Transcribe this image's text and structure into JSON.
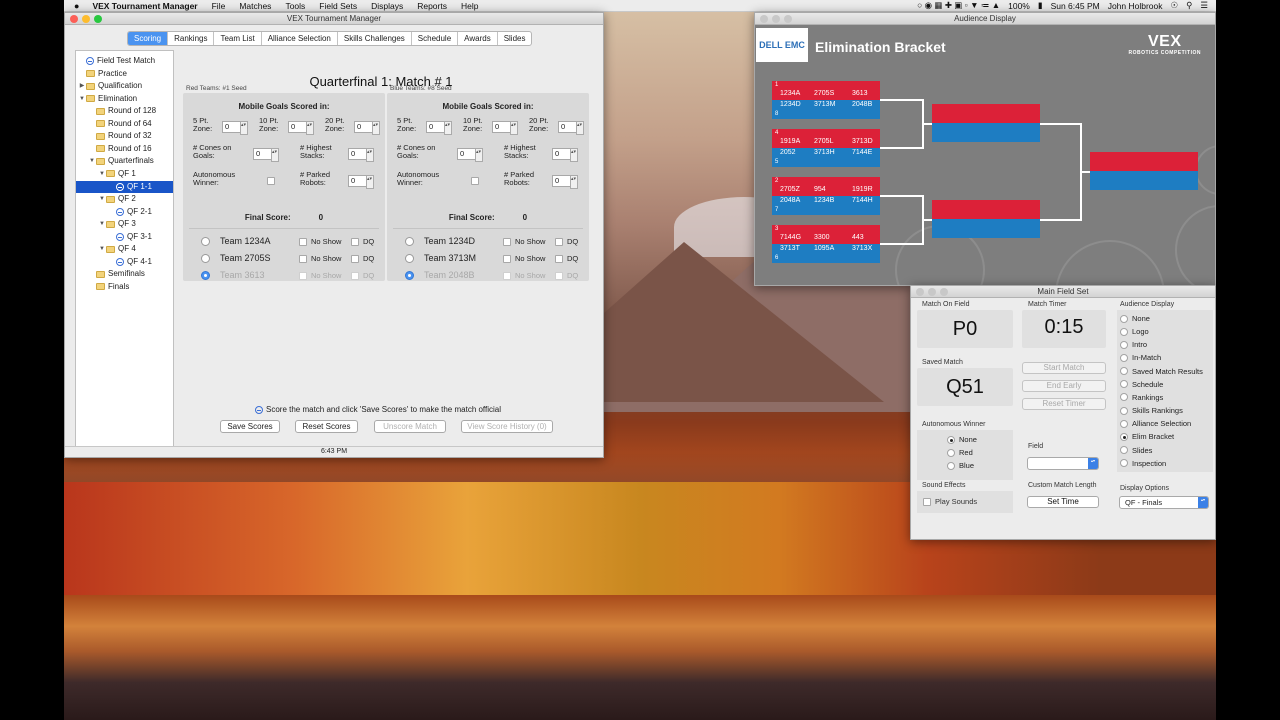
{
  "menubar": {
    "app": "VEX Tournament Manager",
    "items": [
      "File",
      "Matches",
      "Tools",
      "Field Sets",
      "Displays",
      "Reports",
      "Help"
    ],
    "battery": "100%",
    "clock": "Sun 6:45 PM",
    "user": "John Holbrook"
  },
  "main": {
    "title": "VEX Tournament Manager",
    "tabs": [
      "Scoring",
      "Rankings",
      "Team List",
      "Alliance Selection",
      "Skills Challenges",
      "Schedule",
      "Awards",
      "Slides"
    ],
    "tree": [
      {
        "label": "Field Test Match",
        "kind": "match",
        "indent": 0,
        "toggle": ""
      },
      {
        "label": "Practice",
        "kind": "folder",
        "indent": 0,
        "toggle": ""
      },
      {
        "label": "Qualification",
        "kind": "folder",
        "indent": 0,
        "toggle": "▶"
      },
      {
        "label": "Elimination",
        "kind": "folder",
        "indent": 0,
        "toggle": "▼"
      },
      {
        "label": "Round of 128",
        "kind": "folder",
        "indent": 1,
        "toggle": ""
      },
      {
        "label": "Round of 64",
        "kind": "folder",
        "indent": 1,
        "toggle": ""
      },
      {
        "label": "Round of 32",
        "kind": "folder",
        "indent": 1,
        "toggle": ""
      },
      {
        "label": "Round of 16",
        "kind": "folder",
        "indent": 1,
        "toggle": ""
      },
      {
        "label": "Quarterfinals",
        "kind": "folder",
        "indent": 1,
        "toggle": "▼"
      },
      {
        "label": "QF 1",
        "kind": "folder",
        "indent": 2,
        "toggle": "▼"
      },
      {
        "label": "QF 1-1",
        "kind": "match",
        "indent": 3,
        "toggle": "",
        "selected": true
      },
      {
        "label": "QF 2",
        "kind": "folder",
        "indent": 2,
        "toggle": "▼"
      },
      {
        "label": "QF 2-1",
        "kind": "match",
        "indent": 3,
        "toggle": ""
      },
      {
        "label": "QF 3",
        "kind": "folder",
        "indent": 2,
        "toggle": "▼"
      },
      {
        "label": "QF 3-1",
        "kind": "match",
        "indent": 3,
        "toggle": ""
      },
      {
        "label": "QF 4",
        "kind": "folder",
        "indent": 2,
        "toggle": "▼"
      },
      {
        "label": "QF 4-1",
        "kind": "match",
        "indent": 3,
        "toggle": ""
      },
      {
        "label": "Semifinals",
        "kind": "folder",
        "indent": 1,
        "toggle": ""
      },
      {
        "label": "Finals",
        "kind": "folder",
        "indent": 1,
        "toggle": ""
      }
    ],
    "heading": "Quarterfinal 1: Match # 1",
    "alliances": [
      {
        "header": "Red Teams: #1 Seed",
        "goals_title": "Mobile Goals Scored in:",
        "zone5": "5 Pt. Zone:",
        "zone10": "10 Pt. Zone:",
        "zone20": "20 Pt. Zone:",
        "cones": "# Cones on Goals:",
        "stacks": "# Highest Stacks:",
        "auton": "Autonomous Winner:",
        "parked": "# Parked Robots:",
        "v5": "0",
        "v10": "0",
        "v20": "0",
        "vcones": "0",
        "vstacks": "0",
        "vparked": "0",
        "final_label": "Final Score:",
        "final_value": "0",
        "teams": [
          {
            "name": "Team 1234A",
            "selected": false,
            "dim": false
          },
          {
            "name": "Team 2705S",
            "selected": false,
            "dim": false
          },
          {
            "name": "Team 3613",
            "selected": true,
            "dim": true
          }
        ]
      },
      {
        "header": "Blue Teams: #8 Seed",
        "goals_title": "Mobile Goals Scored in:",
        "zone5": "5 Pt. Zone:",
        "zone10": "10 Pt. Zone:",
        "zone20": "20 Pt. Zone:",
        "cones": "# Cones on Goals:",
        "stacks": "# Highest Stacks:",
        "auton": "Autonomous Winner:",
        "parked": "# Parked Robots:",
        "v5": "0",
        "v10": "0",
        "v20": "0",
        "vcones": "0",
        "vstacks": "0",
        "vparked": "0",
        "final_label": "Final Score:",
        "final_value": "0",
        "teams": [
          {
            "name": "Team 1234D",
            "selected": false,
            "dim": false
          },
          {
            "name": "Team 3713M",
            "selected": false,
            "dim": false
          },
          {
            "name": "Team 2048B",
            "selected": true,
            "dim": true
          }
        ]
      }
    ],
    "no_show": "No Show",
    "dq": "DQ",
    "note": "Score the match and click 'Save Scores' to make the match official",
    "buttons": {
      "save": "Save Scores",
      "reset": "Reset Scores",
      "unscore": "Unscore Match",
      "history": "View Score History (0)"
    },
    "time": "6:43 PM"
  },
  "audience": {
    "title": "Audience Display",
    "logo": "DELL EMC",
    "heading": "Elimination Bracket",
    "vex": "VEX",
    "vex_sub": "ROBOTICS COMPETITION",
    "brackets": [
      {
        "red_seed": "1",
        "red": [
          "1234A",
          "2705S",
          "3613"
        ],
        "blue_seed": "8",
        "blue": [
          "1234D",
          "3713M",
          "2048B"
        ]
      },
      {
        "red_seed": "4",
        "red": [
          "1919A",
          "2705L",
          "3713D"
        ],
        "blue_seed": "5",
        "blue": [
          "2052",
          "3713H",
          "7144E"
        ]
      },
      {
        "red_seed": "2",
        "red": [
          "2705Z",
          "954",
          "1919R"
        ],
        "blue_seed": "7",
        "blue": [
          "2048A",
          "1234B",
          "7144H"
        ]
      },
      {
        "red_seed": "3",
        "red": [
          "7144G",
          "3300",
          "443"
        ],
        "blue_seed": "6",
        "blue": [
          "3713T",
          "1095A",
          "3713X"
        ]
      }
    ]
  },
  "fieldset": {
    "title": "Main Field Set",
    "match_on_field_label": "Match On Field",
    "match_on_field": "P0",
    "timer_label": "Match Timer",
    "timer": "0:15",
    "saved_label": "Saved Match",
    "saved": "Q51",
    "start": "Start Match",
    "end": "End Early",
    "reset": "Reset Timer",
    "auton_label": "Autonomous Winner",
    "auton_options": [
      "None",
      "Red",
      "Blue"
    ],
    "auton_selected": 0,
    "field_label": "Field",
    "field_value": "",
    "sound_label": "Sound Effects",
    "play_sounds": "Play Sounds",
    "custom_label": "Custom Match Length",
    "set_time": "Set Time",
    "display_label": "Audience Display",
    "display_options": [
      "None",
      "Logo",
      "Intro",
      "In-Match",
      "Saved Match Results",
      "Schedule",
      "Rankings",
      "Skills Rankings",
      "Alliance Selection",
      "Elim Bracket",
      "Slides",
      "Inspection"
    ],
    "display_selected": 9,
    "display_opts_label": "Display Options",
    "display_opts_value": "QF - Finals"
  }
}
